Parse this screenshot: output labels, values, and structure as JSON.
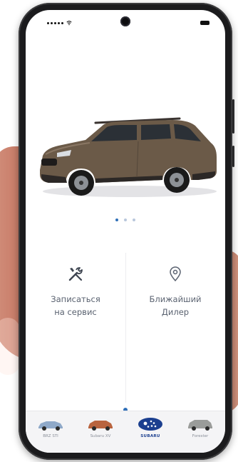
{
  "status_bar": {
    "signal_icon": "signal-dots-icon",
    "wifi_icon": "wifi-icon",
    "battery_icon": "battery-icon"
  },
  "carousel": {
    "slide_count": 3,
    "active_index": 0,
    "car_color": "#6b5a48"
  },
  "actions": [
    {
      "icon": "wrench-screwdriver-icon",
      "label_line1": "Записаться",
      "label_line2": "на сервис"
    },
    {
      "icon": "location-pin-icon",
      "label_line1": "Ближайший",
      "label_line2": "Дилер"
    }
  ],
  "bottom_nav": {
    "items": [
      {
        "label": "BRZ STI",
        "car_color": "#8fa9c9",
        "active": false
      },
      {
        "label": "Subaru XV",
        "car_color": "#b9643f",
        "active": false
      },
      {
        "label": "SUBARU",
        "active": true,
        "logo_color": "#1b3f8f"
      },
      {
        "label": "Forester",
        "car_color": "#9a9c9a",
        "active": false
      }
    ]
  },
  "colors": {
    "accent": "#2f6fb8",
    "brand_blue": "#1b3f8f",
    "text_gray": "#5a6270"
  }
}
